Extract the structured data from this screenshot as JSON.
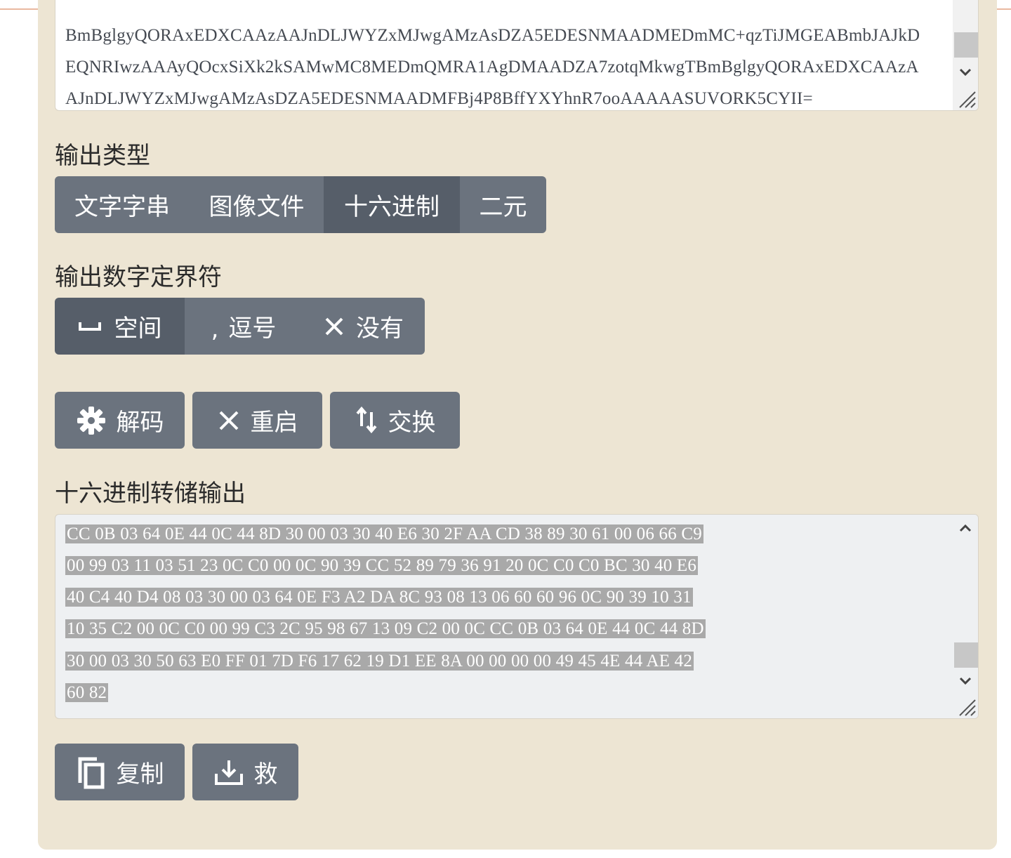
{
  "input_text": {
    "lines": [
      "BmBglgyQORAxEDXCAAzAAJnDLJWYZxMJwgAMzAsDZA5EDESNMAADMEDmMC+qzTiJMGEABmbJAJkD",
      "EQNRIwzAAAyQOcxSiXk2kSAMwMC8MEDmQMRA1AgDMAADZA7zotqMkwgTBmBglgyQORAxEDXCAAzA",
      "AJnDLJWYZxMJwgAMzAsDZA5EDESNMAADMFBj4P8BffYXYhnR7ooAAAAASUVORK5CYII="
    ]
  },
  "output_type": {
    "label": "输出类型",
    "options": [
      "文字字串",
      "图像文件",
      "十六进制",
      "二元"
    ],
    "selected": "十六进制"
  },
  "delimiter": {
    "label": "输出数字定界符",
    "options": [
      {
        "label": "空间",
        "icon": "space-icon"
      },
      {
        "label": "逗号",
        "icon": "comma-icon"
      },
      {
        "label": "没有",
        "icon": "x-icon"
      }
    ],
    "selected": "空间"
  },
  "actions": {
    "decode_label": "解码",
    "reset_label": "重启",
    "swap_label": "交换"
  },
  "hex_output": {
    "label": "十六进制转储输出",
    "lines": [
      "CC 0B 03 64 0E 44 0C 44 8D 30 00 03 30 40 E6 30 2F AA CD 38 89 30 61 00 06 66 C9",
      "00 99 03 11 03 51 23 0C C0 00 0C 90 39 CC 52 89 79 36 91 20 0C C0 C0 BC 30 40 E6",
      "40 C4 40 D4 08 03 30 00 03 64 0E F3 A2 DA 8C 93 08 13 06 60 60 96 0C 90 39 10 31",
      "10 35 C2 00 0C C0 00 99 C3 2C 95 98 67 13 09 C2 00 0C CC 0B 03 64 0E 44 0C 44 8D",
      "30 00 03 30 50 63 E0 FF 01 7D F6 17 62 19 D1 EE 8A 00 00 00 00 49 45 4E 44 AE 42",
      "60 82"
    ]
  },
  "bottom_actions": {
    "copy_label": "复制",
    "save_label": "救"
  },
  "colors": {
    "panel_bg": "#ede5d3",
    "button": "#6b737e",
    "button_active": "#565e69",
    "selection": "#a9a9a9"
  }
}
